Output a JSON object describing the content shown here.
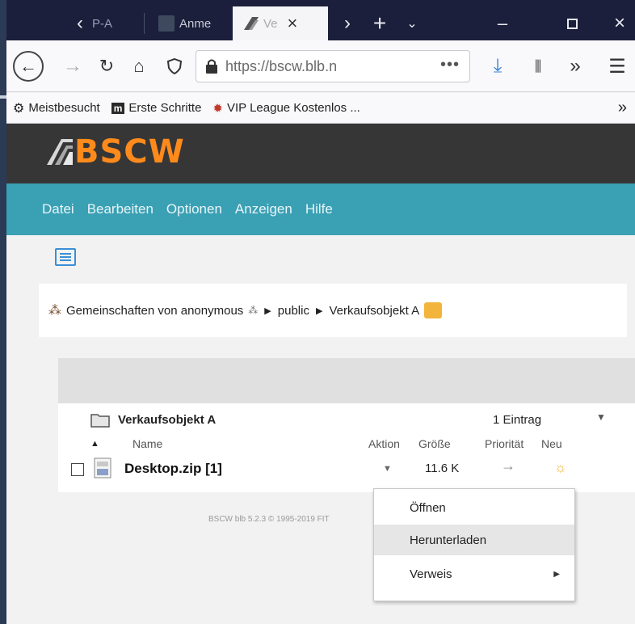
{
  "browser": {
    "tabs": [
      {
        "label": "P-A",
        "active": false
      },
      {
        "label": "Anme",
        "active": false
      },
      {
        "label": "Ve",
        "active": true
      }
    ],
    "url": "https://bscw.blb.n",
    "url_more": "•••",
    "bookmarks": [
      {
        "label": "Meistbesucht",
        "icon": "gear-icon"
      },
      {
        "label": "Erste Schritte",
        "icon": "m-logo-icon"
      },
      {
        "label": "VIP League Kostenlos ...",
        "icon": "bug-icon"
      }
    ],
    "bookmarks_overflow": "»"
  },
  "app": {
    "logo": "BSCW",
    "colors": {
      "logo": "#ff8a1c",
      "header": "#363636",
      "menubar": "#3aa0b4"
    },
    "menu": [
      "Datei",
      "Bearbeiten",
      "Optionen",
      "Anzeigen",
      "Hilfe"
    ]
  },
  "breadcrumb": {
    "root": "Gemeinschaften von anonymous",
    "items": [
      "public",
      "Verkaufsobjekt A"
    ]
  },
  "listing": {
    "folder": "Verkaufsobjekt A",
    "count": "1 Eintrag",
    "columns": {
      "name": "Name",
      "action": "Aktion",
      "size": "Größe",
      "priority": "Priorität",
      "new": "Neu"
    },
    "rows": [
      {
        "name": "Desktop.zip [1]",
        "size": "11.6 K",
        "priority": "→",
        "new": "☼"
      }
    ]
  },
  "footer": "BSCW blb 5.2.3 © 1995-2019 FIT",
  "context_menu": {
    "items": [
      {
        "label": "Öffnen",
        "highlighted": false
      },
      {
        "label": "Herunterladen",
        "highlighted": true
      },
      {
        "label": "Verweis",
        "highlighted": false,
        "submenu": true
      }
    ]
  }
}
